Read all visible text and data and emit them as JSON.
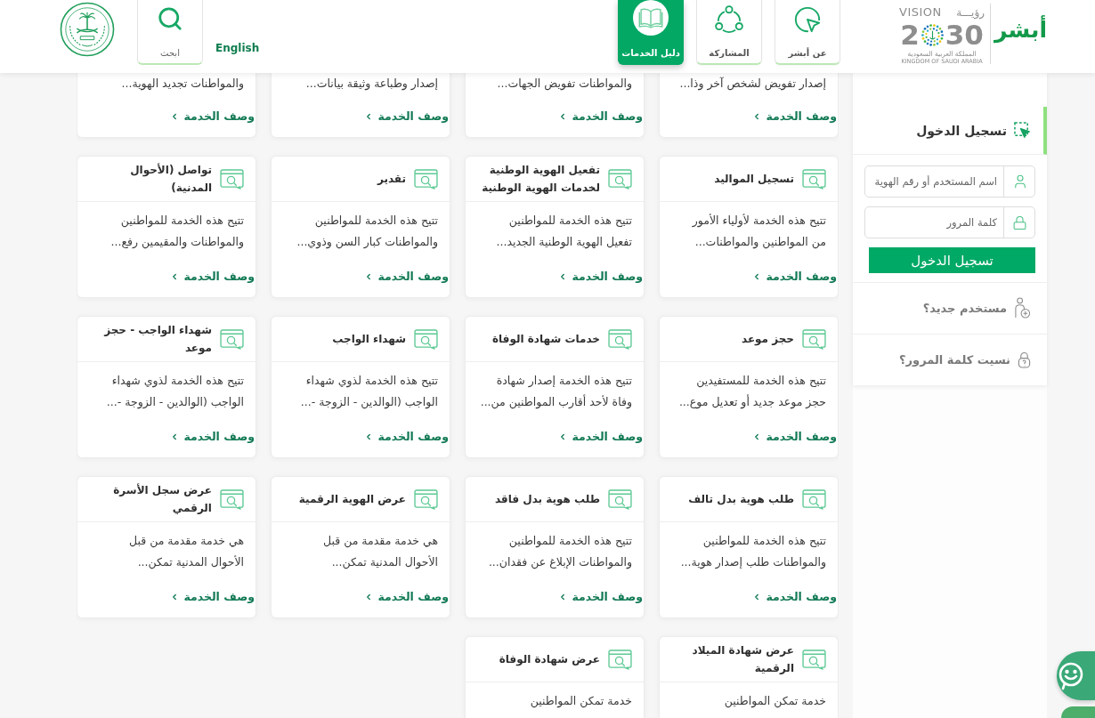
{
  "header": {
    "brand": "أبشر",
    "vision_logo": {
      "word_ar": "رؤيـــة",
      "word_en": "VISION",
      "year_parts": [
        "30",
        "2"
      ],
      "country_ar": "المملكة العربية السعودية",
      "country_en": "KINGDOM OF SAUDI ARABIA"
    },
    "nav": [
      {
        "label": "عن أبشر",
        "kind": "about",
        "selected": false
      },
      {
        "label": "المشاركة",
        "kind": "participation",
        "selected": false
      },
      {
        "label": "دليل الخدمات",
        "kind": "guide",
        "selected": true
      }
    ],
    "language_link": "English",
    "search": {
      "label": "ابحث"
    }
  },
  "login": {
    "title": "تسجيل الدخول",
    "selected": true,
    "username_placeholder": "اسم المستخدم أو رقم الهوية",
    "password_placeholder": "كلمة المرور",
    "submit": "تسجيل الدخول",
    "links": [
      {
        "label": "مستخدم جديد؟",
        "kind": "new_user"
      },
      {
        "label": "نسيت كلمة المرور؟",
        "kind": "forgot_password"
      }
    ]
  },
  "service_rows": [
    {
      "kind": "cut_top",
      "cards": [
        {
          "description": [
            "إصدار تفويض لشخص آخر وذا..."
          ],
          "link": "وصف الخدمة"
        },
        {
          "description": [
            "والمواطنات تفويض الجهات..."
          ],
          "link": "وصف الخدمة"
        },
        {
          "description": [
            "إصدار وطباعة وثيقة بيانات..."
          ],
          "link": "وصف الخدمة"
        },
        {
          "description": [
            "والمواطنات تجديد الهوية..."
          ],
          "link": "وصف الخدمة"
        }
      ]
    },
    {
      "kind": "full",
      "cards": [
        {
          "title": "تسجيل المواليد",
          "description": [
            "تتيح هذه الخدمة لأولياء الأمور",
            "من المواطنين والمواطنات..."
          ],
          "link": "وصف الخدمة"
        },
        {
          "title": "تفعيل الهوية الوطنية لخدمات الهوية الوطنية",
          "description": [
            "تتيح هذه الخدمة للمواطنين",
            "تفعيل الهوية الوطنية الجديد..."
          ],
          "link": "وصف الخدمة"
        },
        {
          "title": "تقدير",
          "description": [
            "تتيح هذه الخدمة للمواطنين",
            "والمواطنات كبار السن وذوي..."
          ],
          "link": "وصف الخدمة"
        },
        {
          "title": "تواصل (الأحوال المدنية)",
          "description": [
            "تتيح هذه الخدمة للمواطنين",
            "والمواطنات والمقيمين رفع..."
          ],
          "link": "وصف الخدمة"
        }
      ]
    },
    {
      "kind": "full",
      "cards": [
        {
          "title": "حجز موعد",
          "description": [
            "تتيح هذه الخدمة للمستفيدين",
            "حجز موعد جديد أو تعديل موع..."
          ],
          "link": "وصف الخدمة"
        },
        {
          "title": "خدمات شهادة الوفاة",
          "description": [
            "تتيح هذه الخدمة إصدار شهادة",
            "وفاة لأحد أقارب المواطنين من..."
          ],
          "link": "وصف الخدمة"
        },
        {
          "title": "شهداء الواجب",
          "description": [
            "تتيح هذه الخدمة لذوي شهداء",
            "الواجب (الوالدين - الزوجة -..."
          ],
          "link": "وصف الخدمة"
        },
        {
          "title": "شهداء الواجب - حجز موعد",
          "description": [
            "تتيح هذه الخدمة لذوي شهداء",
            "الواجب (الوالدين - الزوجة -..."
          ],
          "link": "وصف الخدمة"
        }
      ]
    },
    {
      "kind": "full",
      "cards": [
        {
          "title": "طلب هوية بدل تالف",
          "description": [
            "تتيح هذه الخدمة للمواطنين",
            "والمواطنات طلب إصدار هوية..."
          ],
          "link": "وصف الخدمة"
        },
        {
          "title": "طلب هوية بدل فاقد",
          "description": [
            "تتيح هذه الخدمة للمواطنين",
            "والمواطنات الإبلاغ عن فقدان..."
          ],
          "link": "وصف الخدمة"
        },
        {
          "title": "عرض الهوية الرقمية",
          "description": [
            "هي خدمة مقدمة من قبل",
            "الأحوال المدنية تمكن..."
          ],
          "link": "وصف الخدمة"
        },
        {
          "title": "عرض سجل الأسرة الرقمي",
          "description": [
            "هي خدمة مقدمة من قبل",
            "الأحوال المدنية تمكن..."
          ],
          "link": "وصف الخدمة"
        }
      ]
    },
    {
      "kind": "cut_bottom",
      "cards": [
        {
          "title": "عرض شهادة الميلاد الرقمية",
          "description": [
            "خدمة تمكن المواطنين"
          ]
        },
        {
          "title": "عرض شهادة الوفاة",
          "description": [
            "خدمة تمكن المواطنين"
          ]
        }
      ]
    }
  ]
}
